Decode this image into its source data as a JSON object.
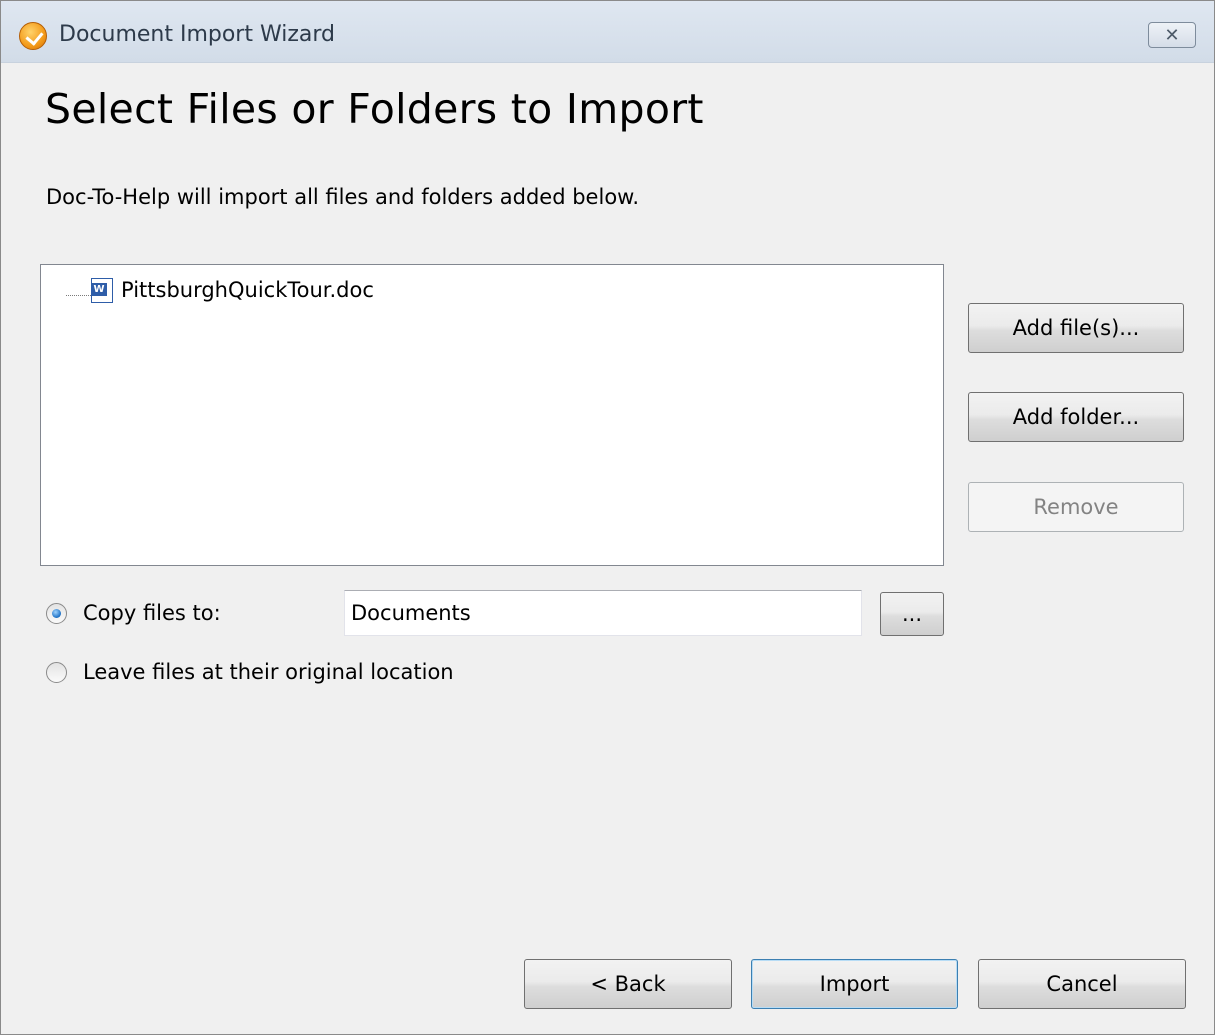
{
  "window": {
    "title": "Document Import Wizard",
    "close_label": "☒"
  },
  "page": {
    "heading": "Select Files or Folders to Import",
    "description": "Doc-To-Help will import all files and folders added below."
  },
  "file_list": {
    "items": [
      {
        "label": "PittsburghQuickTour.doc",
        "icon": "word-document-icon"
      }
    ]
  },
  "side_buttons": {
    "add_files": "Add file(s)...",
    "add_folder": "Add folder...",
    "remove": "Remove"
  },
  "options": {
    "copy_files_label": "Copy files to:",
    "copy_files_selected": true,
    "copy_files_path": "Documents",
    "browse_label": "...",
    "leave_files_label": "Leave files at their original location",
    "leave_files_selected": false
  },
  "footer": {
    "back": "< Back",
    "import": "Import",
    "cancel": "Cancel"
  },
  "colors": {
    "window_bg": "#f0f0f0",
    "titlebar": "#d2dce8",
    "default_button_border": "#3c7fb1"
  }
}
